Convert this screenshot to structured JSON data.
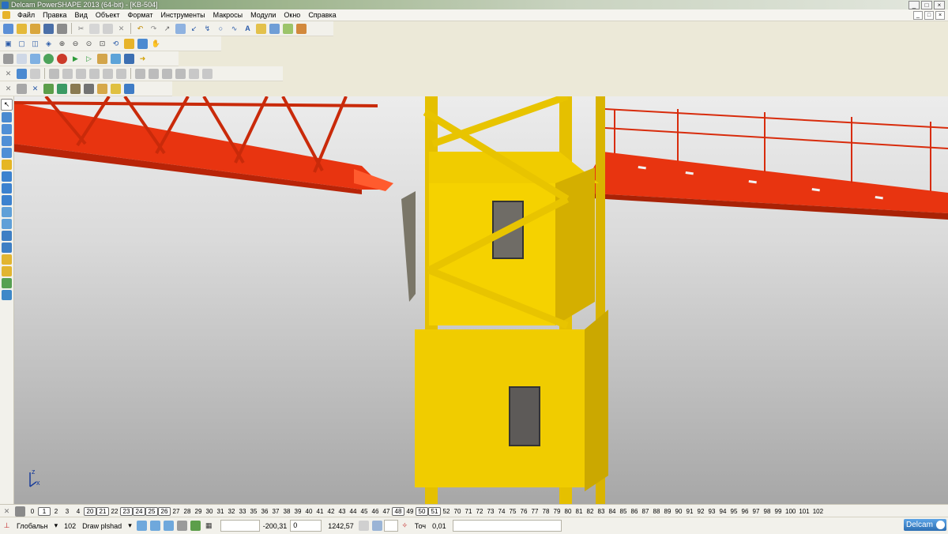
{
  "window": {
    "title": "Delcam PowerSHAPE 2013 (64-bit) - [KB-504]",
    "controls": [
      "_",
      "□",
      "×"
    ]
  },
  "menu": {
    "items": [
      "Файл",
      "Правка",
      "Вид",
      "Объект",
      "Формат",
      "Инструменты",
      "Макросы",
      "Модули",
      "Окно",
      "Справка"
    ],
    "doc_controls": [
      "_",
      "□",
      "×"
    ]
  },
  "toolbars": [
    {
      "row": 1,
      "icons": [
        "new-icon",
        "open-icon",
        "open-recent-icon",
        "save-icon",
        "print-icon",
        "cut-icon",
        "copy-icon",
        "paste-icon",
        "delete-icon",
        "undo-icon",
        "redo-icon",
        "selection-icon",
        "wireframe-icon",
        "shaded-icon",
        "lightning-icon",
        "circle-icon",
        "curve-icon",
        "text-icon",
        "points-icon",
        "layers-icon",
        "material-icon",
        "tools-icon"
      ]
    },
    {
      "row": 2,
      "icons": [
        "view-box-icon",
        "view-front-icon",
        "view-top-icon",
        "view-iso-icon",
        "zoom-in-icon",
        "zoom-out-icon",
        "zoom-all-icon",
        "zoom-window-icon",
        "rotate-icon",
        "shade-toggle-icon",
        "hide-icon",
        "hand-icon"
      ]
    },
    {
      "row": 3,
      "icons": [
        "calc-icon",
        "doc-icon",
        "model-icon",
        "sphere-icon",
        "cone-icon",
        "play-icon",
        "play-outline-icon",
        "box-icon",
        "transform-icon",
        "info-icon",
        "arrow-icon"
      ]
    },
    {
      "row": 4,
      "icons": [
        "solid-icon",
        "fillet-icon",
        "blend-icon",
        "extrude-icon",
        "revolve-icon",
        "shell-icon",
        "boolean-icon",
        "cut-solid-icon",
        "intersect-icon",
        "split-icon",
        "chamfer-icon",
        "draft-icon",
        "feature-icon",
        "undo-feature-icon",
        "history-icon"
      ]
    },
    {
      "row": 5,
      "icons": [
        "surface-icon",
        "curve-tool-icon",
        "solid-box-icon",
        "solid-sphere-icon",
        "assembly-icon",
        "part-icon",
        "grid-icon",
        "shade-icon",
        "feature-tree-icon",
        "diagnose-icon"
      ]
    }
  ],
  "left_tools": [
    "select-icon",
    "curve-tool-icon",
    "surface-tool-icon",
    "solid-tool-icon",
    "wireframe-tool-icon",
    "dimension-tool-icon",
    "symbol-tool-icon",
    "text-tool-icon",
    "block-tool-icon",
    "mesh-tool-icon",
    "electrode-tool-icon",
    "assembly-tool-icon",
    "die-tool-icon",
    "mold-tool-icon",
    "sheet-tool-icon",
    "workplane-tool-icon",
    "analysis-tool-icon"
  ],
  "levels": [
    "0",
    "1",
    "2",
    "3",
    "4",
    "20",
    "21",
    "22",
    "23",
    "24",
    "25",
    "26",
    "27",
    "28",
    "29",
    "30",
    "31",
    "32",
    "33",
    "35",
    "36",
    "37",
    "38",
    "39",
    "40",
    "41",
    "42",
    "43",
    "44",
    "45",
    "46",
    "47",
    "48",
    "49",
    "50",
    "51",
    "52",
    "70",
    "71",
    "72",
    "73",
    "74",
    "75",
    "76",
    "77",
    "78",
    "79",
    "80",
    "81",
    "82",
    "83",
    "84",
    "85",
    "86",
    "87",
    "88",
    "89",
    "90",
    "91",
    "92",
    "93",
    "94",
    "95",
    "96",
    "97",
    "98",
    "99",
    "100",
    "101",
    "102"
  ],
  "active_levels": [
    "1",
    "20",
    "21",
    "23",
    "24",
    "25",
    "26",
    "48",
    "50",
    "51"
  ],
  "status": {
    "mode": "Глобальн",
    "level_number": "102",
    "level_name": "Draw plshad",
    "x": "-200,31",
    "y": "0",
    "z": "1242,57",
    "tolerance_label": "Точ",
    "tolerance": "0,01"
  },
  "brand": "Delcam",
  "axes": {
    "x": "x",
    "z": "z"
  },
  "colors": {
    "crane_yellow": "#f0cc00",
    "jib_red": "#e83410",
    "background_top": "#ececec",
    "background_bottom": "#a7a7a7"
  }
}
